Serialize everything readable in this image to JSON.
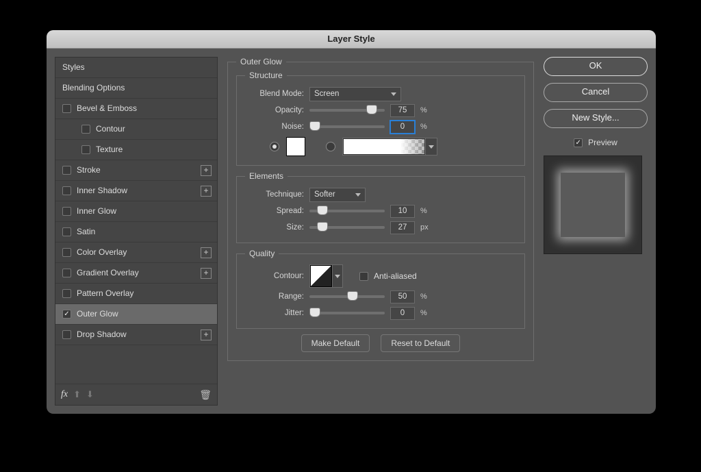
{
  "window": {
    "title": "Layer Style"
  },
  "sidebar": {
    "headers": {
      "styles": "Styles",
      "options": "Blending Options"
    },
    "items": [
      {
        "label": "Bevel & Emboss",
        "checked": false,
        "plus": false
      },
      {
        "label": "Contour",
        "checked": false,
        "indent": true
      },
      {
        "label": "Texture",
        "checked": false,
        "indent": true
      },
      {
        "label": "Stroke",
        "checked": false,
        "plus": true
      },
      {
        "label": "Inner Shadow",
        "checked": false,
        "plus": true
      },
      {
        "label": "Inner Glow",
        "checked": false,
        "plus": false
      },
      {
        "label": "Satin",
        "checked": false,
        "plus": false
      },
      {
        "label": "Color Overlay",
        "checked": false,
        "plus": true
      },
      {
        "label": "Gradient Overlay",
        "checked": false,
        "plus": true
      },
      {
        "label": "Pattern Overlay",
        "checked": false,
        "plus": false
      },
      {
        "label": "Outer Glow",
        "checked": true,
        "plus": false,
        "selected": true
      },
      {
        "label": "Drop Shadow",
        "checked": false,
        "plus": true
      }
    ],
    "footer": {
      "fx": "fx"
    }
  },
  "panel": {
    "title": "Outer Glow",
    "structure": {
      "legend": "Structure",
      "blend_mode": {
        "label": "Blend Mode:",
        "value": "Screen"
      },
      "opacity": {
        "label": "Opacity:",
        "value": "75",
        "unit": "%",
        "pos": 75
      },
      "noise": {
        "label": "Noise:",
        "value": "0",
        "unit": "%",
        "pos": 0,
        "focused": true
      },
      "color": "#ffffff"
    },
    "elements": {
      "legend": "Elements",
      "technique": {
        "label": "Technique:",
        "value": "Softer"
      },
      "spread": {
        "label": "Spread:",
        "value": "10",
        "unit": "%",
        "pos": 10
      },
      "size": {
        "label": "Size:",
        "value": "27",
        "unit": "px",
        "pos": 10
      }
    },
    "quality": {
      "legend": "Quality",
      "contour": {
        "label": "Contour:"
      },
      "antialias": {
        "label": "Anti-aliased",
        "checked": false
      },
      "range": {
        "label": "Range:",
        "value": "50",
        "unit": "%",
        "pos": 50
      },
      "jitter": {
        "label": "Jitter:",
        "value": "0",
        "unit": "%",
        "pos": 0
      }
    },
    "buttons": {
      "make_default": "Make Default",
      "reset_default": "Reset to Default"
    }
  },
  "right": {
    "ok": "OK",
    "cancel": "Cancel",
    "new_style": "New Style...",
    "preview": {
      "label": "Preview",
      "checked": true
    }
  }
}
